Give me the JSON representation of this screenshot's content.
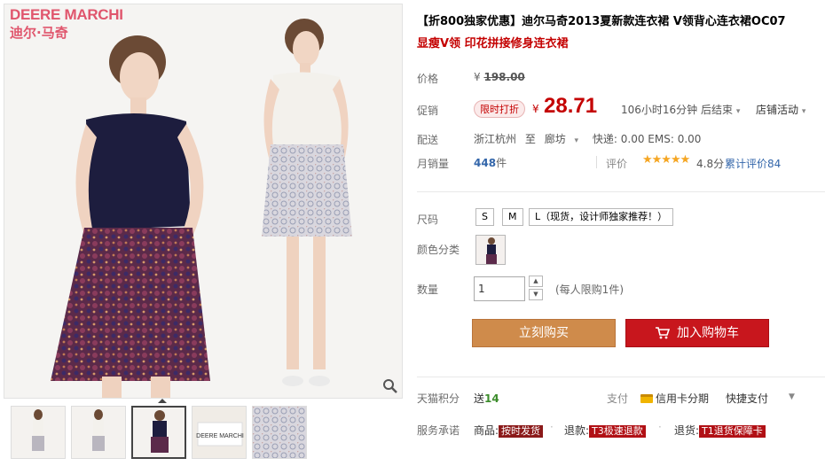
{
  "gallery": {
    "brand_en": "DEERE MARCHI",
    "brand_cn": "迪尔·马奇",
    "thumbnail_label": "DEERE MARCHI"
  },
  "product": {
    "title": "【折800独家优惠】迪尔马奇2013夏新款连衣裙 V领背心连衣裙OC07",
    "subtitle": "显瘦V领 印花拼接修身连衣裙"
  },
  "price": {
    "label": "价格",
    "currency": "¥",
    "original": "198.00",
    "promo_label": "促销",
    "promo_badge": "限时打折",
    "promo_price": "28.71",
    "countdown": "106小时16分钟 后结束",
    "shop_promo": "店铺活动"
  },
  "shipping": {
    "label": "配送",
    "from": "浙江杭州",
    "to_word": "至",
    "to": "廊坊",
    "fee": "快递: 0.00 EMS: 0.00"
  },
  "sales": {
    "label": "月销量",
    "count": "448",
    "unit": "件",
    "rating_label": "评价",
    "stars": "★★★★★",
    "score": "4.8分",
    "reviews": "累计评价84"
  },
  "size": {
    "label": "尺码",
    "options": [
      "S",
      "M",
      "L（现货，设计师独家推荐！）"
    ]
  },
  "color": {
    "label": "颜色分类"
  },
  "quantity": {
    "label": "数量",
    "value": "1",
    "limit": "(每人限购1件)"
  },
  "buttons": {
    "buy": "立刻购买",
    "cart": "加入购物车"
  },
  "points": {
    "label": "天猫积分",
    "prefix": "送",
    "value": "14"
  },
  "payment": {
    "label": "支付",
    "credit": "信用卡分期",
    "quick": "快捷支付"
  },
  "service": {
    "label": "服务承诺",
    "goods_label": "商品:",
    "goods_tag": "按时发货",
    "refund_label": "退款:",
    "refund_tag": "T3极速退款",
    "return_label": "退货:",
    "return_tag": "T1退货保障卡"
  },
  "colors": {
    "accent_red": "#c40000",
    "buy_orange": "#cf8b4b",
    "cart_red": "#c8161d",
    "brand_pink": "#e0566d"
  }
}
